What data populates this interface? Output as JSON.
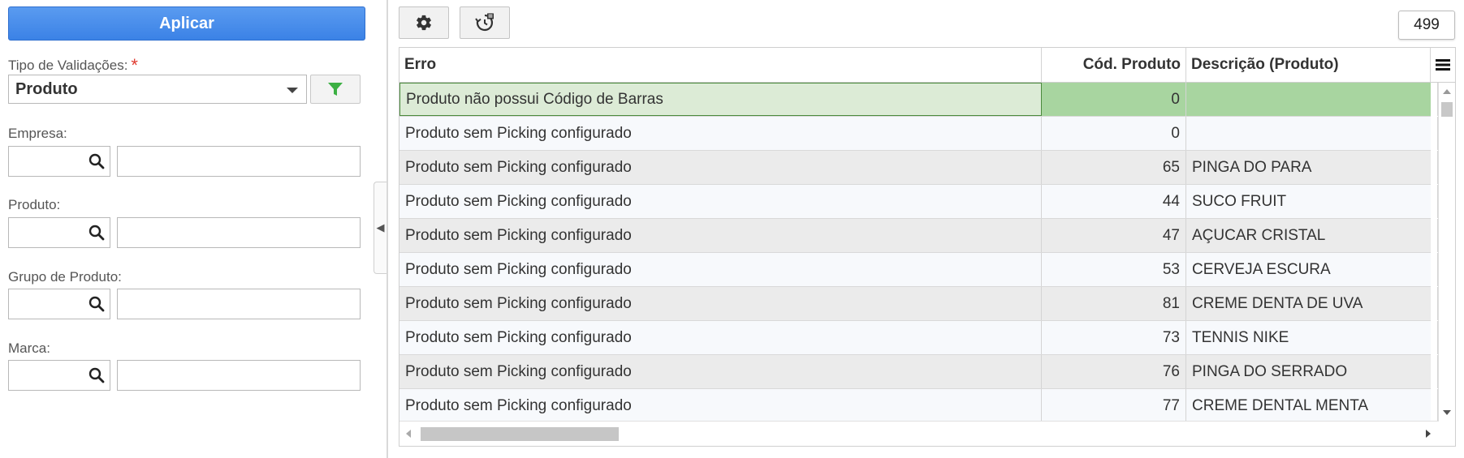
{
  "filters": {
    "apply_label": "Aplicar",
    "validation_type_label": "Tipo de Validações:",
    "required_mark": "*",
    "validation_type_value": "Produto",
    "empresa_label": "Empresa:",
    "produto_label": "Produto:",
    "grupo_label": "Grupo de Produto:",
    "marca_label": "Marca:"
  },
  "toolbar": {
    "record_count": "499"
  },
  "grid": {
    "columns": [
      "Erro",
      "Cód. Produto",
      "Descrição (Produto)"
    ],
    "rows": [
      {
        "erro": "Produto não possui Código de Barras",
        "codigo": "0",
        "descricao": ""
      },
      {
        "erro": "Produto sem Picking configurado",
        "codigo": "0",
        "descricao": ""
      },
      {
        "erro": "Produto sem Picking configurado",
        "codigo": "65",
        "descricao": "PINGA DO PARA"
      },
      {
        "erro": "Produto sem Picking configurado",
        "codigo": "44",
        "descricao": "SUCO FRUIT"
      },
      {
        "erro": "Produto sem Picking configurado",
        "codigo": "47",
        "descricao": "AÇUCAR CRISTAL"
      },
      {
        "erro": "Produto sem Picking configurado",
        "codigo": "53",
        "descricao": "CERVEJA ESCURA"
      },
      {
        "erro": "Produto sem Picking configurado",
        "codigo": "81",
        "descricao": "CREME DENTA DE UVA"
      },
      {
        "erro": "Produto sem Picking configurado",
        "codigo": "73",
        "descricao": "TENNIS NIKE"
      },
      {
        "erro": "Produto sem Picking configurado",
        "codigo": "76",
        "descricao": "PINGA DO SERRADO"
      },
      {
        "erro": "Produto sem Picking configurado",
        "codigo": "77",
        "descricao": "CREME DENTAL MENTA"
      }
    ]
  },
  "colors": {
    "accent_blue": "#3b82e6",
    "selected_row": "#a8d5a0",
    "filter_green": "#3cb043"
  }
}
